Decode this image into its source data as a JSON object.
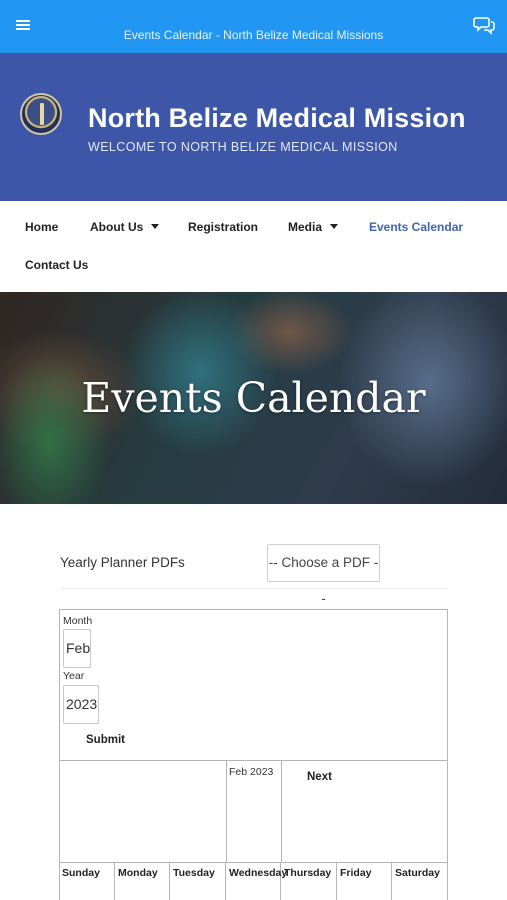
{
  "appbar": {
    "title": "Events Calendar - North Belize Medical Missions",
    "menu_icon": "menu-icon",
    "chat_icon": "chat-icon",
    "color": "#2196f3"
  },
  "header": {
    "title": "North Belize Medical Mission",
    "tagline": "WELCOME TO NORTH BELIZE MEDICAL MISSION",
    "background": "#3d56a8"
  },
  "nav": {
    "home": "Home",
    "about": "About Us",
    "registration": "Registration",
    "media": "Media",
    "events": "Events Calendar",
    "contact": "Contact Us",
    "active_color": "#3e64b1"
  },
  "hero": {
    "title": "Events Calendar"
  },
  "planner": {
    "label": "Yearly Planner PDFs",
    "select_value": "-- Choose a PDF --"
  },
  "calendar": {
    "month_label": "Month",
    "month_value": "Feb",
    "year_label": "Year",
    "year_value": "2023",
    "submit_label": "Submit",
    "current_month": "Feb 2023",
    "next_label": "Next",
    "days": [
      "Sunday",
      "Monday",
      "Tuesday",
      "Wednesday",
      "Thursday",
      "Friday",
      "Saturday"
    ]
  }
}
